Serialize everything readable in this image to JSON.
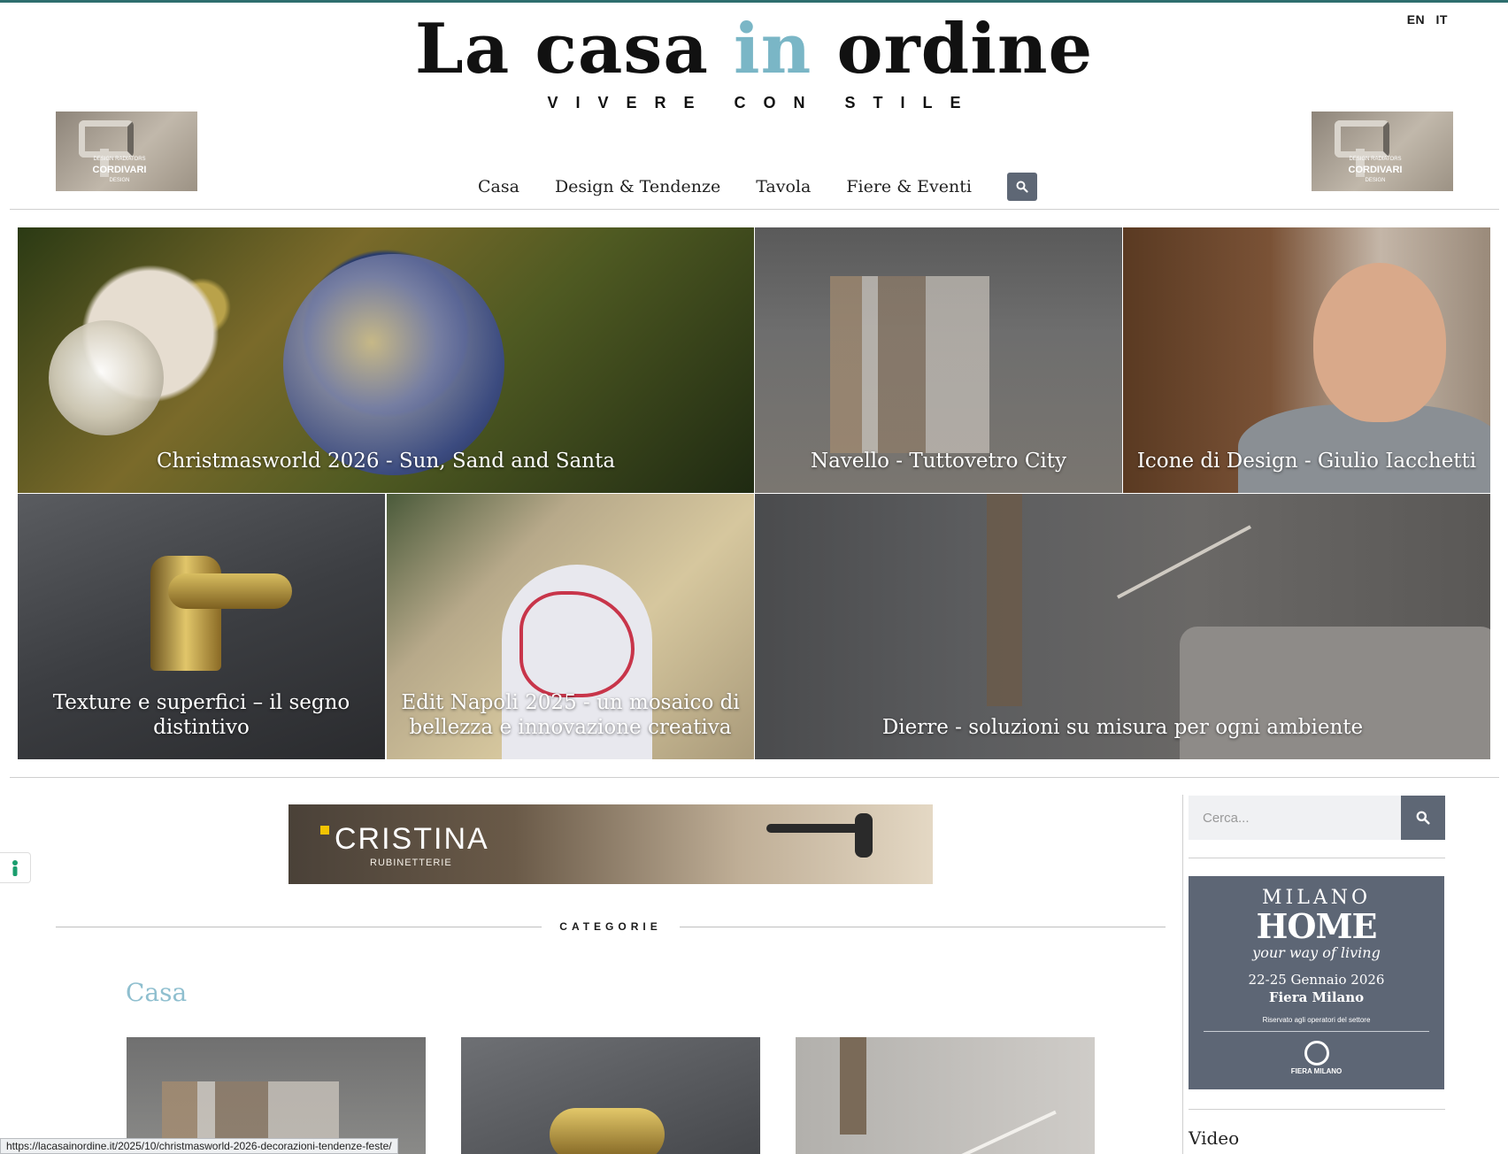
{
  "language_switch": [
    "EN",
    "IT"
  ],
  "logo": {
    "main_before": "La casa ",
    "main_accent": "in",
    "main_after": " ordine",
    "tagline": "VIVERE CON STILE"
  },
  "side_ads": {
    "left": {
      "line1": "DESIGN RADIATORS",
      "brand": "CORDIVARI",
      "line3": "DESIGN"
    },
    "right": {
      "line1": "DESIGN RADIATORS",
      "brand": "CORDIVARI",
      "line3": "DESIGN"
    }
  },
  "nav": {
    "items": [
      "Casa",
      "Design & Tendenze",
      "Tavola",
      "Fiere & Eventi"
    ],
    "search_icon": "search-icon"
  },
  "featured": [
    {
      "title": "Christmasworld 2026 - Sun, Sand and Santa"
    },
    {
      "title": "Navello - Tuttovetro City"
    },
    {
      "title": "Icone di Design - Giulio Iacchetti"
    },
    {
      "title": "Texture e superfici – il segno distintivo"
    },
    {
      "title": "Edit Napoli 2025 - un mosaico di bellezza e innovazione creativa"
    },
    {
      "title": "Dierre - soluzioni su misura per ogni ambiente"
    }
  ],
  "banner": {
    "brand": "CRISTINA",
    "sub": "RUBINETTERIE"
  },
  "categorie_heading": "CATEGORIE",
  "casa_section": {
    "title": "Casa"
  },
  "sidebar": {
    "search_placeholder": "Cerca...",
    "milano_ad": {
      "line1": "MILANO",
      "line2": "HOME",
      "line3": "your way of living",
      "dates": "22-25 Gennaio 2026",
      "venue": "Fiera Milano",
      "note": "Riservato agli operatori del settore",
      "logo_text": "FIERA MILANO"
    },
    "video_label": "Video"
  },
  "status_url": "https://lacasainordine.it/2025/10/christmasworld-2026-decorazioni-tendenze-feste/",
  "colors": {
    "accent": "#7ab6c6",
    "casa_title": "#8fbfcf",
    "button": "#5e6775",
    "milano_bg": "#5d6675"
  }
}
